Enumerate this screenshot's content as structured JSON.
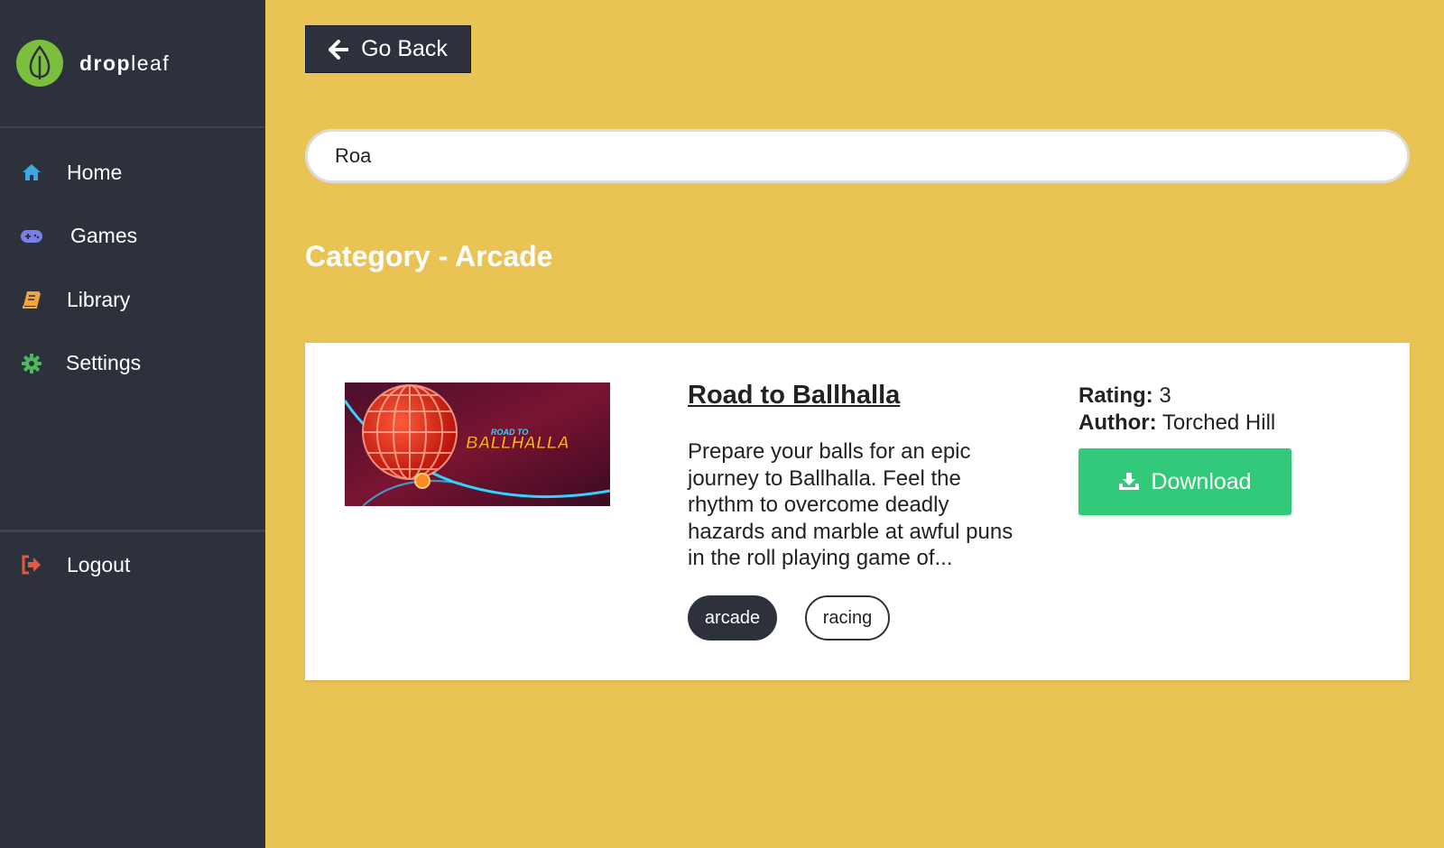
{
  "brand": {
    "name_bold": "drop",
    "name_light": "leaf",
    "logo_color": "#7cbf3c"
  },
  "sidebar": {
    "items": [
      {
        "label": "Home",
        "icon": "home-icon",
        "color": "#3ea6e0"
      },
      {
        "label": "Games",
        "icon": "gamepad-icon",
        "color": "#7b7de8"
      },
      {
        "label": "Library",
        "icon": "book-icon",
        "color": "#f0a640"
      },
      {
        "label": "Settings",
        "icon": "gear-icon",
        "color": "#4cb860"
      }
    ],
    "logout": {
      "label": "Logout",
      "icon": "logout-icon",
      "color": "#e05a45"
    }
  },
  "toolbar": {
    "back_label": "Go Back"
  },
  "search": {
    "value": "Roa"
  },
  "category": {
    "title": "Category - Arcade"
  },
  "game": {
    "title": "Road to Ballhalla",
    "thumb_text_top": "ROAD TO",
    "thumb_text_main": "BALLHALLA",
    "description": "Prepare your balls for an epic journey to Ballhalla. Feel the rhythm to overcome deadly hazards and marble at awful puns in the roll playing game of...",
    "tags": [
      "arcade",
      "racing"
    ],
    "rating_label": "Rating:",
    "rating_value": "3",
    "author_label": "Author:",
    "author_value": "Torched Hill",
    "download_label": "Download"
  },
  "colors": {
    "background": "#eac355",
    "sidebar": "#2d313c",
    "download": "#33c97a"
  }
}
